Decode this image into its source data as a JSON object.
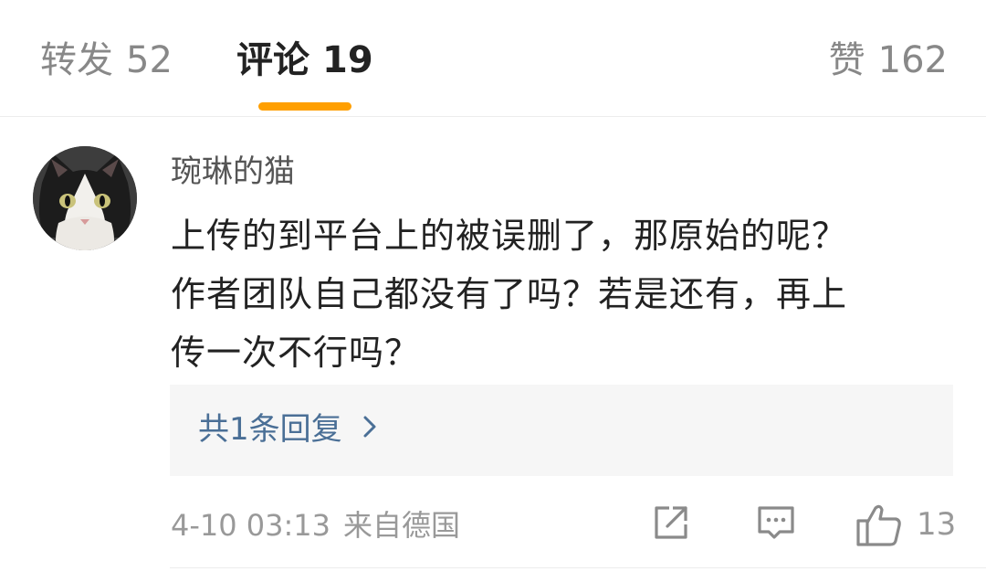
{
  "tabs": {
    "repost": {
      "label": "转发",
      "count": "52"
    },
    "comment": {
      "label": "评论",
      "count": "19"
    },
    "like": {
      "label": "赞",
      "count": "162"
    },
    "active": "comment",
    "accent_color": "#ff9f00"
  },
  "comment": {
    "author": "琬琳的猫",
    "avatar": "cat-avatar",
    "text_lines": [
      "上传的到平台上的被误删了，那原始的呢？",
      "作者团队自己都没有了吗？若是还有，再上",
      "传一次不行吗？"
    ],
    "replies_link": "共1条回复",
    "timestamp": "4-10 03:13",
    "source": "来自德国",
    "like_count": "13",
    "link_color": "#4a6f96"
  },
  "icons": {
    "share": "share-icon",
    "reply": "comment-icon",
    "like": "thumbs-up-icon",
    "chevron": "chevron-right-icon"
  }
}
